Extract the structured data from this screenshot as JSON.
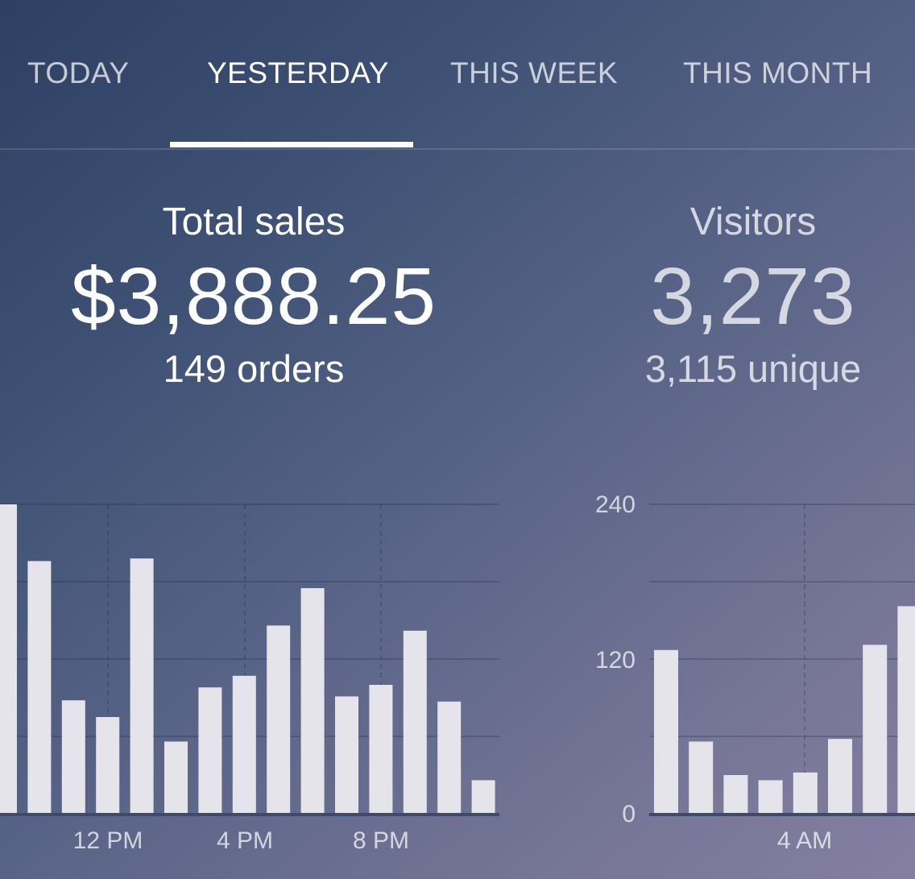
{
  "tabs": [
    {
      "label": "TODAY",
      "active": false
    },
    {
      "label": "YESTERDAY",
      "active": true
    },
    {
      "label": "THIS WEEK",
      "active": false
    },
    {
      "label": "THIS MONTH",
      "active": false
    }
  ],
  "sales": {
    "label": "Total sales",
    "value": "$3,888.25",
    "sub": "149 orders"
  },
  "visitors": {
    "label": "Visitors",
    "value": "3,273",
    "sub": "3,115 unique"
  },
  "colors": {
    "bar": "#e4e4ea",
    "grid": "rgba(30,40,70,0.35)",
    "baseline": "#3d4a6c"
  },
  "chart_data": [
    {
      "type": "bar",
      "name": "sales-by-hour",
      "x_tick_labels": [
        "12 PM",
        "4 PM",
        "8 PM"
      ],
      "values": [
        240,
        196,
        88,
        75,
        198,
        56,
        98,
        107,
        146,
        175,
        91,
        100,
        142,
        87,
        26
      ],
      "ylim": [
        0,
        240
      ],
      "grid": true
    },
    {
      "type": "bar",
      "name": "visitors-by-hour",
      "y_tick_labels": [
        "240",
        "120",
        "0"
      ],
      "x_tick_labels": [
        "4 AM"
      ],
      "values": [
        127,
        56,
        30,
        26,
        32,
        58,
        131,
        161
      ],
      "ylim": [
        0,
        240
      ],
      "grid": true
    }
  ]
}
